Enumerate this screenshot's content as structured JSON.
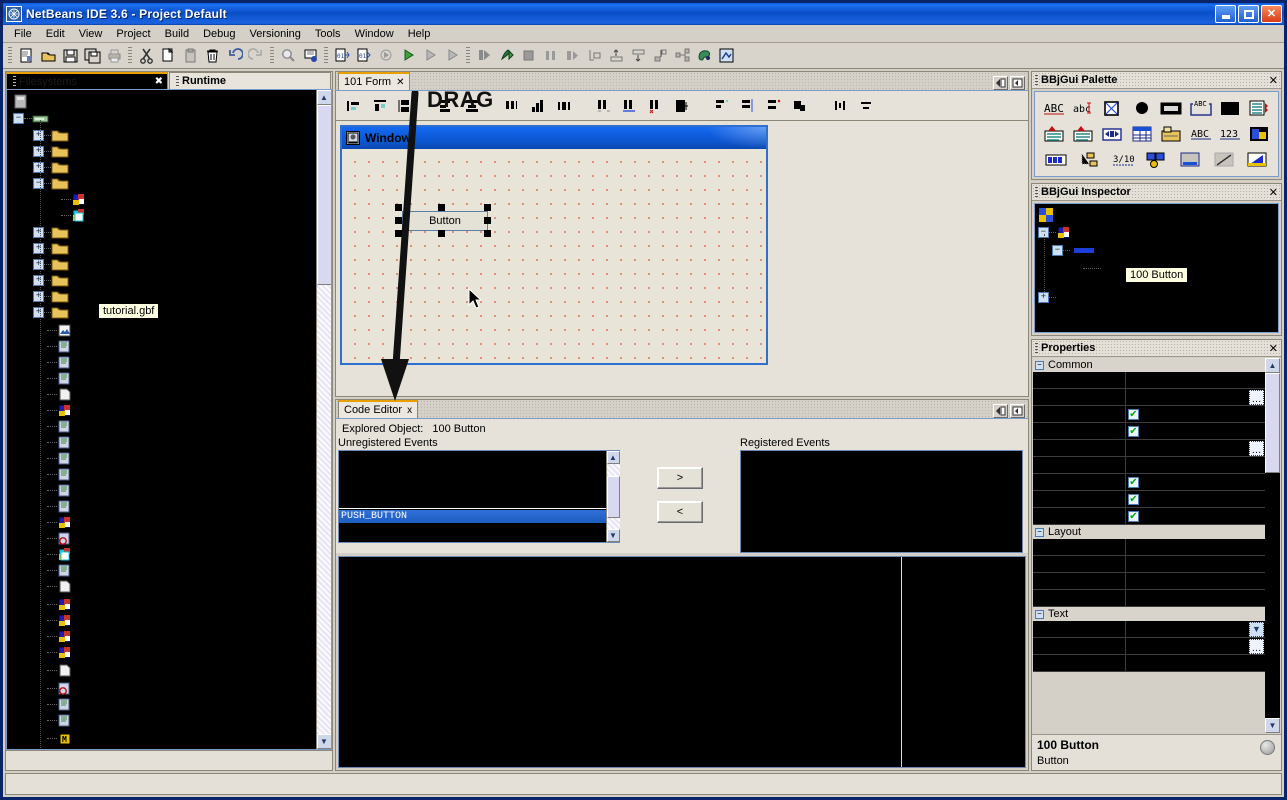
{
  "window": {
    "title": "NetBeans IDE 3.6 - Project Default",
    "app_icon": "netbeans-icon",
    "minimize_label": "_",
    "maximize_label": "□",
    "close_label": "✕"
  },
  "menubar": {
    "items": [
      {
        "label": "File",
        "mnemonic": "F"
      },
      {
        "label": "Edit",
        "mnemonic": "E"
      },
      {
        "label": "View",
        "mnemonic": "V"
      },
      {
        "label": "Project",
        "mnemonic": "P"
      },
      {
        "label": "Build",
        "mnemonic": "B"
      },
      {
        "label": "Debug",
        "mnemonic": "D"
      },
      {
        "label": "Versioning",
        "mnemonic": "s"
      },
      {
        "label": "Tools",
        "mnemonic": "T"
      },
      {
        "label": "Window",
        "mnemonic": "W"
      },
      {
        "label": "Help",
        "mnemonic": "H"
      }
    ]
  },
  "toolbar": {
    "groups": [
      [
        "new-file-icon",
        "open-file-icon",
        "save-icon",
        "save-all-icon",
        "print-icon"
      ],
      [
        "cut-icon",
        "copy-icon",
        "paste-icon",
        "delete-icon",
        "undo-icon",
        "redo-icon"
      ],
      [
        "find-icon",
        "find-replace-icon"
      ],
      [
        "compile-icon",
        "compile-all-icon",
        "build-icon",
        "execute-icon",
        "run-icon",
        "run-continue-icon",
        "run-step-icon"
      ],
      [
        "debug-icon",
        "debug-run-icon",
        "stop-icon",
        "pause-icon",
        "step-over-icon",
        "step-into-icon",
        "step-out-icon",
        "run-to-cursor-icon",
        "go-to-source-icon",
        "new-breakpoint-icon",
        "palette-icon",
        "component-inspector-icon"
      ]
    ]
  },
  "explorer": {
    "tabs": [
      {
        "label": "Filesystems",
        "active": true,
        "closable": true
      },
      {
        "label": "Runtime",
        "active": false,
        "closable": false
      }
    ],
    "tooltip": "tutorial.gbf",
    "scroll_up": "▲",
    "scroll_down": "▼"
  },
  "designer": {
    "tab": {
      "label": "101 Form",
      "close": "✕"
    },
    "panel_buttons": [
      "float-panel-icon",
      "maximize-panel-icon"
    ],
    "annotation": "DRAG",
    "align_toolbar": [
      "align-left-icon",
      "align-top-icon",
      "align-grid-icon",
      "align-text-left-icon",
      "align-center-icon",
      "same-width-icon",
      "same-height-icon",
      "same-size-icon",
      "space-horizontal-equal-icon",
      "space-horizontal-increase-icon",
      "space-horizontal-decrease-icon",
      "fill-icon",
      "align-rows-top-icon",
      "align-rows-center-icon",
      "align-rows-bottom-icon",
      "bring-to-front-icon",
      "center-horizontal-icon",
      "center-vertical-icon"
    ],
    "form": {
      "title": "Window",
      "icon": "window-icon",
      "controls": [
        {
          "type": "button",
          "label": "Button",
          "selected": true
        }
      ]
    }
  },
  "code_editor": {
    "tab": {
      "label": "Code Editor",
      "close": "x"
    },
    "panel_buttons": [
      "float-panel-icon",
      "maximize-panel-icon"
    ],
    "explored_object_label": "Explored Object:",
    "explored_object_value": "100 Button",
    "unregistered_label": "Unregistered Events",
    "registered_label": "Registered Events",
    "unregistered_events": [
      "PUSH_BUTTON"
    ],
    "selected_event": "PUSH_BUTTON",
    "registered_events": [],
    "add_button": ">",
    "remove_button": "<",
    "scroll_up": "▲",
    "scroll_down": "▼"
  },
  "palette": {
    "title": "BBjGui Palette",
    "close": "✕",
    "rows": [
      [
        "static-text-icon",
        "edit-field-icon",
        "checkbox-icon",
        "radio-button-icon",
        "button-icon",
        "group-box-icon",
        "filled-box-icon",
        "list-button-icon"
      ],
      [
        "list-edit-icon",
        "list-spinner-icon",
        "nav-control-icon",
        "grid-icon",
        "tab-control-icon",
        "input-abc-icon",
        "input-123-icon",
        "image-control-icon"
      ],
      [
        "progress-bar-icon",
        "tree-control-icon",
        "fraction-icon",
        "menu-button-icon",
        "status-bar-icon",
        "line-icon",
        "chart-icon"
      ]
    ]
  },
  "inspector": {
    "title": "BBjGui Inspector",
    "close": "✕",
    "tooltip": "100 Button"
  },
  "properties": {
    "title": "Properties",
    "close": "✕",
    "groups": [
      {
        "name": "Common",
        "rows": [
          {
            "control": "none"
          },
          {
            "control": "ellipsis"
          },
          {
            "control": "checkbox"
          },
          {
            "control": "checkbox"
          },
          {
            "control": "ellipsis"
          },
          {
            "control": "none"
          },
          {
            "control": "checkbox"
          },
          {
            "control": "checkbox"
          },
          {
            "control": "checkbox"
          }
        ]
      },
      {
        "name": "Layout",
        "rows": [
          {
            "control": "none"
          },
          {
            "control": "none"
          },
          {
            "control": "none"
          },
          {
            "control": "none"
          }
        ]
      },
      {
        "name": "Text",
        "rows": [
          {
            "control": "combo"
          },
          {
            "control": "ellipsis"
          },
          {
            "control": "none"
          }
        ]
      }
    ],
    "footer_title": "100 Button",
    "footer_desc": "Button",
    "help_icon": "help-icon",
    "scroll_up": "▲",
    "scroll_down": "▼"
  },
  "statusbar": {
    "text": ""
  },
  "colors": {
    "title_blue": "#0a4fc8",
    "panel_bg": "#d4d0c8",
    "canvas_bg": "#e8e5d8",
    "tab_accent": "#e8a000",
    "selection_blue": "#2f6fd8",
    "black_list": "#000000",
    "form_border": "#2f6fd0",
    "grid_dot": "#e2715a"
  }
}
